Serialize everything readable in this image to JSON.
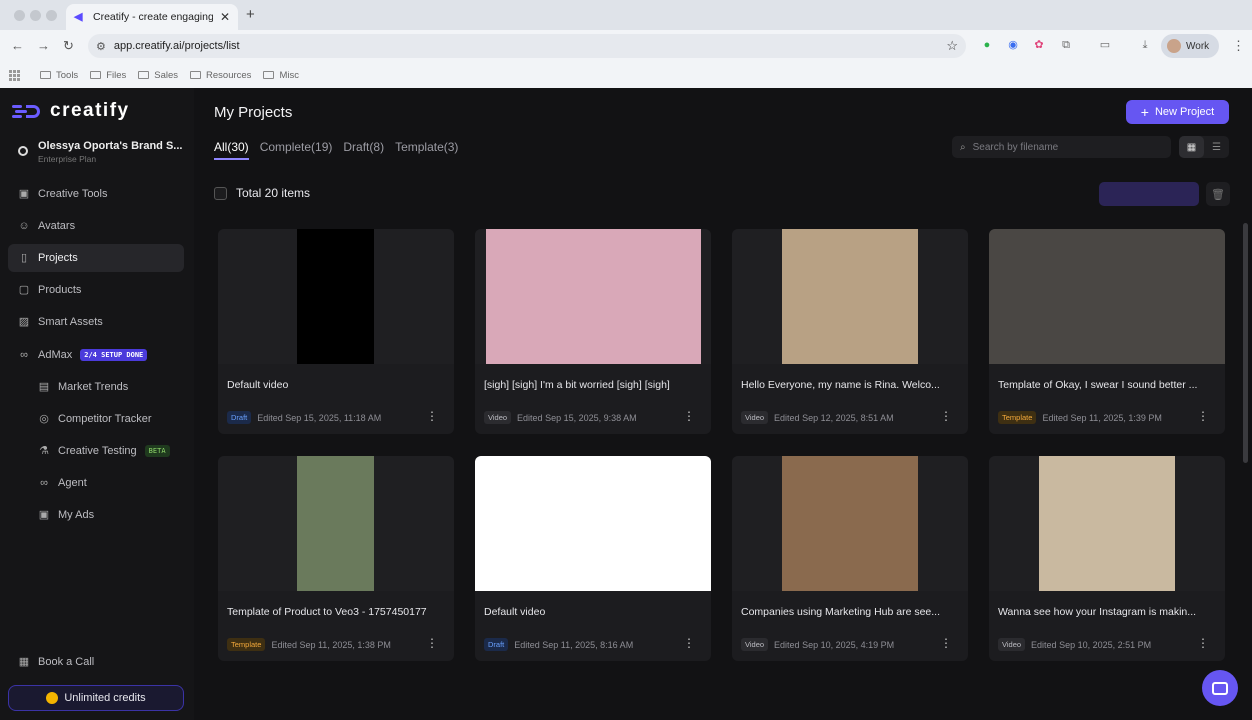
{
  "browser": {
    "tab_title": "Creatify - create engaging vid",
    "url": "app.creatify.ai/projects/list",
    "profile_label": "Work",
    "bookmarks": [
      "Tools",
      "Files",
      "Sales",
      "Resources",
      "Misc"
    ]
  },
  "sidebar": {
    "logo_text": "creatify",
    "brand_name": "Olessya Oporta's Brand S...",
    "plan": "Enterprise Plan",
    "items": [
      {
        "label": "Creative Tools",
        "icon": "wand-icon"
      },
      {
        "label": "Avatars",
        "icon": "avatar-icon"
      },
      {
        "label": "Projects",
        "icon": "file-icon",
        "active": true
      },
      {
        "label": "Products",
        "icon": "box-icon"
      },
      {
        "label": "Smart Assets",
        "icon": "image-icon"
      },
      {
        "label": "AdMax",
        "icon": "infinity-icon",
        "badge": "2/4 SETUP DONE"
      }
    ],
    "subitems": [
      {
        "label": "Market Trends",
        "icon": "chart-icon"
      },
      {
        "label": "Competitor Tracker",
        "icon": "target-icon"
      },
      {
        "label": "Creative Testing",
        "icon": "flask-icon",
        "badge": "BETA"
      },
      {
        "label": "Agent",
        "icon": "infinity-icon"
      },
      {
        "label": "My Ads",
        "icon": "ads-icon"
      }
    ],
    "book_call": "Book a Call",
    "credits": "Unlimited credits"
  },
  "main": {
    "title": "My Projects",
    "new_project": "New Project",
    "filters": [
      "All(30)",
      "Complete(19)",
      "Draft(8)",
      "Template(3)"
    ],
    "search_placeholder": "Search by filename",
    "total": "Total 20 items",
    "cards": [
      {
        "title": "Default video",
        "tag": "Draft",
        "edited": "Edited Sep 15, 2025, 11:18 AM",
        "thumb": "#000000"
      },
      {
        "title": "[sigh] [sigh] I'm a bit worried [sigh] [sigh]",
        "tag": "Video",
        "edited": "Edited Sep 15, 2025, 9:38 AM",
        "thumb": "#d9a8b8"
      },
      {
        "title": "Hello Everyone, my name is Rina. Welco...",
        "tag": "Video",
        "edited": "Edited Sep 12, 2025, 8:51 AM",
        "thumb": "#b8a184"
      },
      {
        "title": "Template of Okay, I swear I sound better ...",
        "tag": "Template",
        "edited": "Edited Sep 11, 2025, 1:39 PM",
        "thumb": "#4a4744"
      },
      {
        "title": "Template of Product to Veo3 - 1757450177",
        "tag": "Template",
        "edited": "Edited Sep 11, 2025, 1:38 PM",
        "thumb": "#6a7a5c"
      },
      {
        "title": "Default video",
        "tag": "Draft",
        "edited": "Edited Sep 11, 2025, 8:16 AM",
        "thumb": "#ffffff"
      },
      {
        "title": "Companies using Marketing Hub are see...",
        "tag": "Video",
        "edited": "Edited Sep 10, 2025, 4:19 PM",
        "thumb": "#8a6a4e"
      },
      {
        "title": "Wanna see how your Instagram is makin...",
        "tag": "Video",
        "edited": "Edited Sep 10, 2025, 2:51 PM",
        "thumb": "#c9b9a0"
      }
    ]
  },
  "colors": {
    "accent": "#6656f2",
    "background": "#121214",
    "card": "#1c1c1f"
  }
}
